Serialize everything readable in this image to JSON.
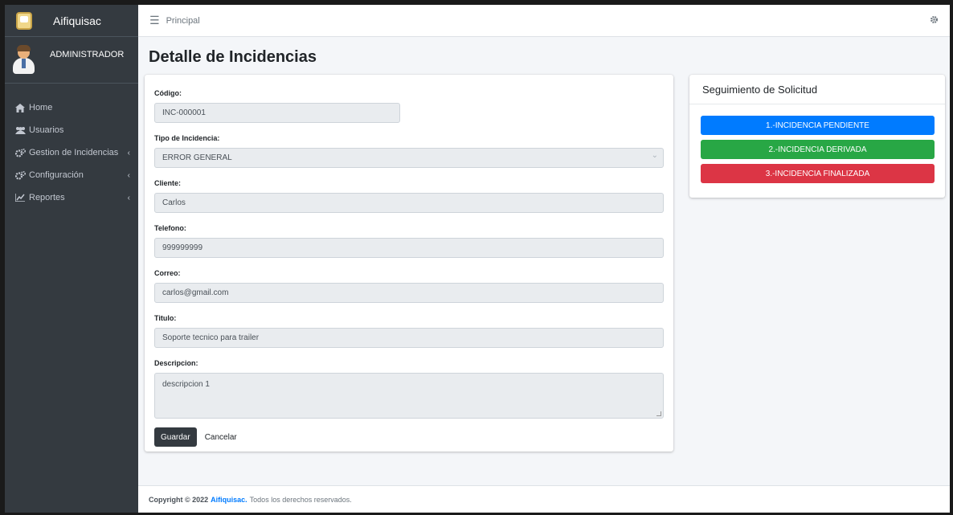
{
  "brand": {
    "name": "Aifiquisac"
  },
  "user": {
    "name": "ADMINISTRADOR"
  },
  "sidebar": {
    "items": [
      {
        "label": "Home",
        "icon": "home-icon",
        "chevron": ""
      },
      {
        "label": "Usuarios",
        "icon": "users-icon",
        "chevron": ""
      },
      {
        "label": "Gestion de Incidencias",
        "icon": "cogs-icon",
        "chevron": "‹"
      },
      {
        "label": "Configuración",
        "icon": "cogs-icon",
        "chevron": "‹"
      },
      {
        "label": "Reportes",
        "icon": "chart-icon",
        "chevron": "‹"
      }
    ]
  },
  "topbar": {
    "breadcrumb": "Principal"
  },
  "page": {
    "title": "Detalle de Incidencias"
  },
  "form": {
    "codigo": {
      "label": "Código:",
      "value": "INC-000001"
    },
    "tipo": {
      "label": "Tipo de Incidencia:",
      "value": "ERROR GENERAL"
    },
    "cliente": {
      "label": "Cliente:",
      "value": "Carlos"
    },
    "telefono": {
      "label": "Telefono:",
      "value": "999999999"
    },
    "correo": {
      "label": "Correo:",
      "value": "carlos@gmail.com"
    },
    "titulo": {
      "label": "Titulo:",
      "value": "Soporte tecnico para trailer"
    },
    "descripcion": {
      "label": "Descripcion:",
      "value": "descripcion 1"
    },
    "save_label": "Guardar",
    "cancel_label": "Cancelar"
  },
  "tracking": {
    "title": "Seguimiento de Solicitud",
    "steps": [
      {
        "label": "1.-INCIDENCIA PENDIENTE",
        "color": "#007bff"
      },
      {
        "label": "2.-INCIDENCIA DERIVADA",
        "color": "#28a745"
      },
      {
        "label": "3.-INCIDENCIA FINALIZADA",
        "color": "#dc3545"
      }
    ]
  },
  "footer": {
    "copyright": "Copyright © 2022",
    "brand": "Aifiquisac.",
    "rights": "Todos los derechos reservados."
  }
}
